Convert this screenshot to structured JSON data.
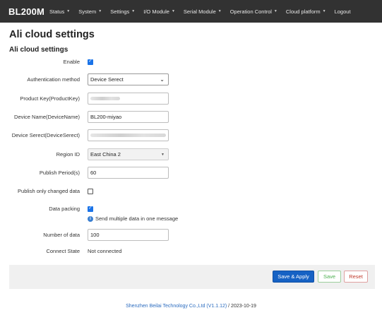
{
  "brand": "BL200M",
  "nav": [
    {
      "label": "Status",
      "caret": "▼"
    },
    {
      "label": "System",
      "caret": "▼"
    },
    {
      "label": "Settings",
      "caret": "▼"
    },
    {
      "label": "I/O Module",
      "caret": "▼"
    },
    {
      "label": "Serial Module",
      "caret": "▼"
    },
    {
      "label": "Operation Control",
      "caret": "▼"
    },
    {
      "label": "Cloud platform",
      "caret": "▼"
    },
    {
      "label": "Logout",
      "caret": ""
    }
  ],
  "page_title": "Ali cloud settings",
  "section_title": "Ali cloud settings",
  "form": {
    "enable": {
      "label": "Enable",
      "checked": true
    },
    "auth_method": {
      "label": "Authentication method",
      "value": "Device Serect"
    },
    "product_key": {
      "label": "Product Key(ProductKey)",
      "value": ""
    },
    "device_name": {
      "label": "Device Name(DeviceName)",
      "value": "BL200-miyao"
    },
    "device_secret": {
      "label": "Device Serect(DeviceSerect)",
      "value": ""
    },
    "region_id": {
      "label": "Region ID",
      "value": "East China 2"
    },
    "publish_period": {
      "label": "Publish Period(s)",
      "value": "60"
    },
    "publish_changed": {
      "label": "Publish only changed data",
      "checked": false
    },
    "data_packing": {
      "label": "Data packing",
      "checked": true,
      "hint": "Send multiple data in one message"
    },
    "number_of_data": {
      "label": "Number of data",
      "value": "100"
    },
    "connect_state": {
      "label": "Connect State",
      "value": "Not connected"
    }
  },
  "buttons": {
    "save_apply": "Save & Apply",
    "save": "Save",
    "reset": "Reset"
  },
  "footer": {
    "company_version": "Shenzhen Beilai Technology Co.,Ltd (V1.1.12)",
    "date": "/ 2023-10-19"
  },
  "colors": {
    "navbar": "#323232",
    "primary_button": "#1662c4",
    "checkbox": "#1a73e8",
    "save_text": "#4caf50",
    "reset_text": "#c0392b"
  },
  "icons": {
    "check": "✓",
    "dropdown": "⌄",
    "info": "i"
  }
}
